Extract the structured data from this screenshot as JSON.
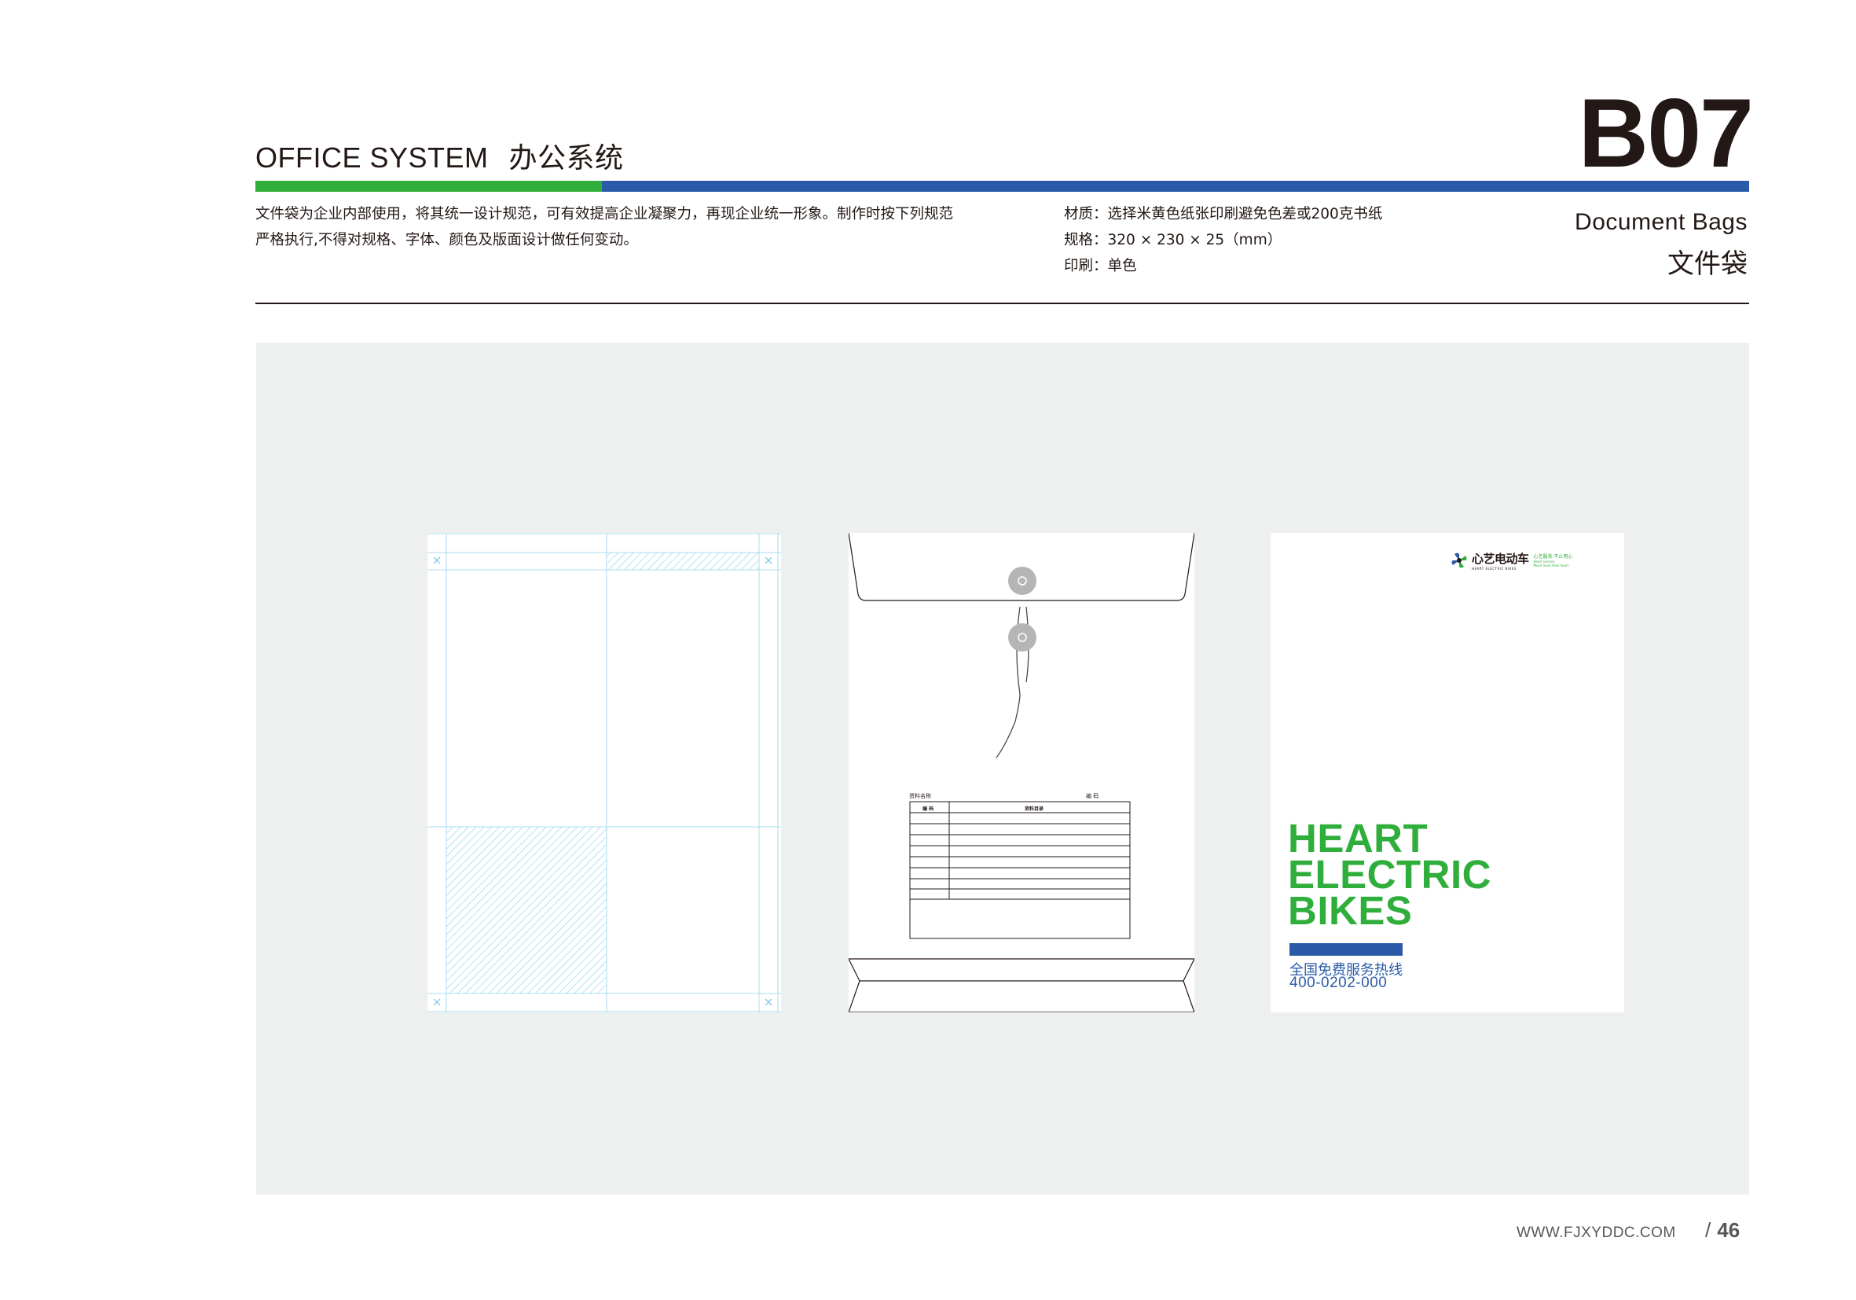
{
  "header": {
    "section_en": "OFFICE SYSTEM",
    "section_cn": "办公系统",
    "page_code": "B07",
    "description": "文件袋为企业内部使用，将其统一设计规范，可有效提高企业凝聚力，再现企业统一形象。制作时按下列规范严格执行,不得对规格、字体、颜色及版面设计做任何变动。",
    "spec_material": "材质：选择米黄色纸张印刷避免色差或200克书纸",
    "spec_size": "规格：320 × 230 × 25（mm）",
    "spec_print": "印刷：单色",
    "title_en": "Document Bags",
    "title_cn": "文件袋"
  },
  "colors": {
    "brand_green": "#2fae3b",
    "brand_blue": "#2b5ba8",
    "guide_blue": "#8fd3ec",
    "canvas_gray": "#eef0ef"
  },
  "icons": {
    "logo": "clover-logo-icon",
    "fastener": "button-fastener-icon"
  },
  "envelope_back": {
    "form_name_label": "资料名称",
    "form_code_label": "编 码",
    "table_col_1": "编 码",
    "table_col_2": "资料目录"
  },
  "envelope_front": {
    "logo_name": "心艺电动车",
    "logo_sub": "HEART ELECTRIC BIKES",
    "logo_slogan_1": "心艺服务 不止用心",
    "logo_slogan_2": "Heart service",
    "logo_slogan_3": "Much more than heart",
    "title_line_1": "HEART",
    "title_line_2": "ELECTRIC",
    "title_line_3": "BIKES",
    "hotline_label": "全国免费服务热线",
    "hotline_number": "400-0202-000"
  },
  "footer": {
    "url": "WWW.FJXYDDC.COM",
    "page_number": "46"
  }
}
